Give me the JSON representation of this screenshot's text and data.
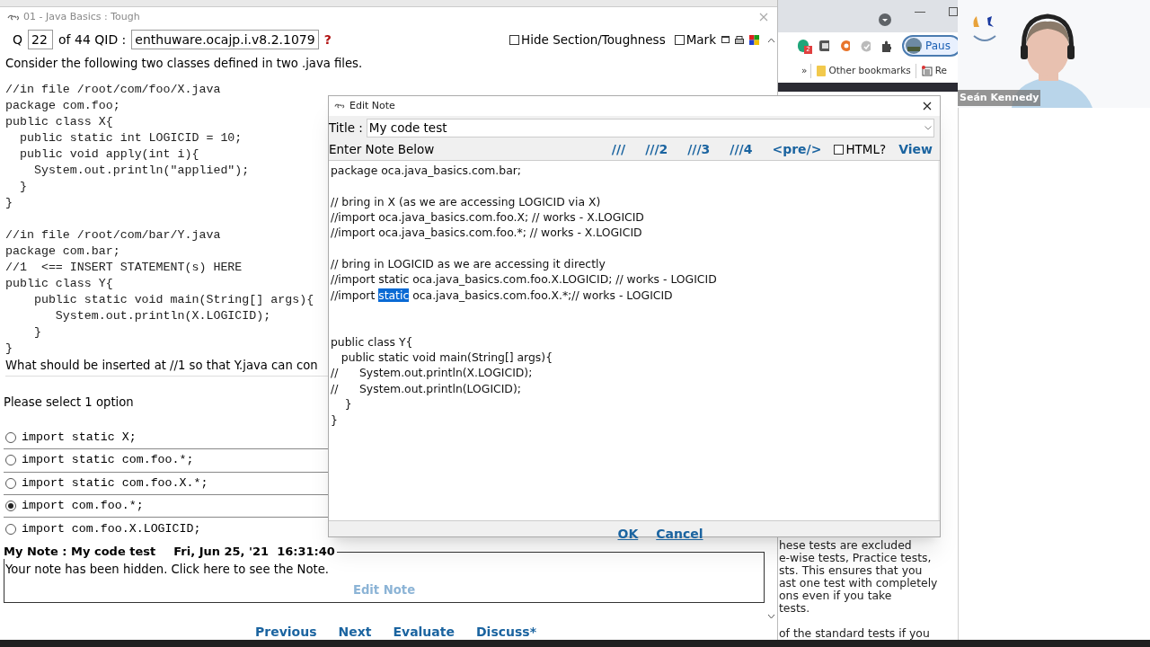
{
  "app_window": {
    "title": "01 - Java Basics : Tough",
    "q_label": "Q",
    "q_number": "22",
    "of_text": "of 44 QID :",
    "qid": "enthuware.ocajp.i.v8.2.1079",
    "help": "?",
    "toggles": [
      {
        "label": "Hide Section/Toughness",
        "checked": false
      },
      {
        "label": "Mark",
        "checked": false
      }
    ],
    "intro": "Consider the following two classes defined in two .java files.",
    "code_blocks": [
      [
        "//in file /root/com/foo/X.java",
        "package com.foo;",
        "public class X{",
        "  public static int LOGICID = 10;",
        "  public void apply(int i){",
        "    System.out.println(\"applied\");",
        "  }",
        "}"
      ],
      [
        "//in file /root/com/bar/Y.java",
        "package com.bar;",
        "//1  <== INSERT STATEMENT(s) HERE",
        "public class Y{",
        "    public static void main(String[] args){",
        "       System.out.println(X.LOGICID);",
        "    }",
        "}"
      ]
    ],
    "question": "What should be inserted at //1 so that Y.java can con",
    "select_hint": "Please select 1 option",
    "options": [
      {
        "text": "import static X;",
        "selected": false
      },
      {
        "text": "import static com.foo.*;",
        "selected": false
      },
      {
        "text": "import static com.foo.X.*;",
        "selected": false
      },
      {
        "text": "import com.foo.*;",
        "selected": true
      },
      {
        "text": "import com.foo.X.LOGICID;",
        "selected": false
      }
    ],
    "note": {
      "legend": "My Note : My code test",
      "date": "Fri, Jun 25, '21  16:31:40",
      "body": "Your note has been hidden. Click here to see the Note.",
      "edit_link": "Edit Note"
    },
    "nav": [
      "Previous",
      "Next",
      "Evaluate",
      "Discuss*"
    ]
  },
  "edit_note_dialog": {
    "title": "Edit Note",
    "title_label": "Title :",
    "title_value": "My code test",
    "prompt": "Enter Note Below",
    "toolbar": [
      "///",
      "///2",
      "///3",
      "///4",
      "<pre/>"
    ],
    "html_toggle": {
      "label": "HTML?",
      "checked": false
    },
    "view_link": "View",
    "lines": [
      {
        "kind": "text",
        "text": "package oca.java_basics.com.bar;"
      },
      {
        "kind": "blank"
      },
      {
        "kind": "text",
        "text": "// bring in X (as we are accessing LOGICID via X)"
      },
      {
        "kind": "text",
        "text": "//import oca.java_basics.com.foo.X; // works - X.LOGICID"
      },
      {
        "kind": "text",
        "text": "//import oca.java_basics.com.foo.*; // works - X.LOGICID"
      },
      {
        "kind": "blank"
      },
      {
        "kind": "text",
        "text": "// bring in LOGICID as we are accessing it directly"
      },
      {
        "kind": "text",
        "text": "//import static oca.java_basics.com.foo.X.LOGICID; // works - LOGICID"
      },
      {
        "kind": "segments",
        "segments": [
          {
            "text": "//import ",
            "selected": false
          },
          {
            "text": "static",
            "selected": true
          },
          {
            "text": " oca.java_basics.com.foo.X.*;// works - LOGICID",
            "selected": false
          }
        ]
      },
      {
        "kind": "blank"
      },
      {
        "kind": "blank"
      },
      {
        "kind": "text",
        "text": "public class Y{"
      },
      {
        "kind": "text",
        "text": "   public static void main(String[] args){"
      },
      {
        "kind": "text",
        "text": "//      System.out.println(X.LOGICID);"
      },
      {
        "kind": "text",
        "text": "//      System.out.println(LOGICID);"
      },
      {
        "kind": "text",
        "text": "    }"
      },
      {
        "kind": "text",
        "text": "}"
      }
    ],
    "buttons": [
      "OK",
      "Cancel"
    ]
  },
  "browser": {
    "extension_badge": "2",
    "profile_label": "Paus",
    "bookmarks_more": "»",
    "bookmarks": [
      "Other bookmarks",
      "Re"
    ],
    "page_paragraphs": [
      [
        "hese tests are excluded",
        "e-wise tests, Practice tests,",
        "sts. This ensures that you",
        "ast one test with completely",
        "ons even if you take",
        "tests."
      ],
      [
        "of the standard tests if you"
      ]
    ]
  },
  "webcam": {
    "kind": "picture",
    "name_label": "Seán Kennedy"
  }
}
